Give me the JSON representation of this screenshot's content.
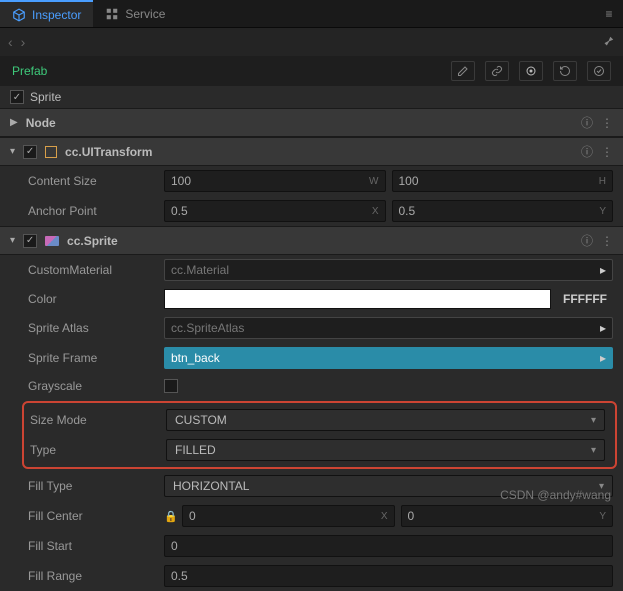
{
  "tabs": {
    "inspector": "Inspector",
    "service": "Service"
  },
  "prefab": {
    "label": "Prefab"
  },
  "node": {
    "name": "Sprite",
    "section": "Node"
  },
  "uitransform": {
    "title": "cc.UITransform",
    "contentSize": {
      "label": "Content Size",
      "w": "100",
      "h": "100",
      "wSuffix": "W",
      "hSuffix": "H"
    },
    "anchorPoint": {
      "label": "Anchor Point",
      "x": "0.5",
      "y": "0.5",
      "xSuffix": "X",
      "ySuffix": "Y"
    }
  },
  "sprite": {
    "title": "cc.Sprite",
    "customMaterial": {
      "label": "CustomMaterial",
      "placeholder": "cc.Material"
    },
    "color": {
      "label": "Color",
      "hex": "FFFFFF"
    },
    "spriteAtlas": {
      "label": "Sprite Atlas",
      "placeholder": "cc.SpriteAtlas"
    },
    "spriteFrame": {
      "label": "Sprite Frame",
      "value": "btn_back"
    },
    "grayscale": {
      "label": "Grayscale"
    },
    "sizeMode": {
      "label": "Size Mode",
      "value": "CUSTOM"
    },
    "type": {
      "label": "Type",
      "value": "FILLED"
    },
    "fillType": {
      "label": "Fill Type",
      "value": "HORIZONTAL"
    },
    "fillCenter": {
      "label": "Fill Center",
      "x": "0",
      "y": "0",
      "xSuffix": "X",
      "ySuffix": "Y"
    },
    "fillStart": {
      "label": "Fill Start",
      "value": "0"
    },
    "fillRange": {
      "label": "Fill Range",
      "value": "0.5"
    }
  },
  "watermark": "CSDN @andy#wang"
}
